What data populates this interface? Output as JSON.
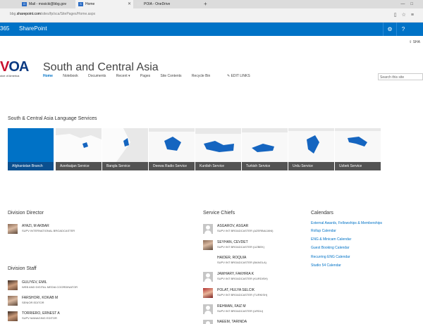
{
  "browser": {
    "tabs": [
      {
        "label": "Mail - mosicki@bbg.gov",
        "icon": "O",
        "active": false
      },
      {
        "label": "Home",
        "icon": "S",
        "active": true
      },
      {
        "label": "POIA - OneDrive",
        "icon": "",
        "active": false
      }
    ],
    "new_tab": "+",
    "url_prefix": "bbg.",
    "url_domain": "sharepoint.com",
    "url_rest": "/sites/fp/sca/SitePages/Home.aspx"
  },
  "suite": {
    "app_prefix": "365",
    "app_name": "SharePoint",
    "accent": "#0072c6"
  },
  "share_label": "SHA",
  "site": {
    "logo_text_v": "V",
    "logo_text_oa": "OA",
    "logo_sub": "oice of America",
    "title": "South and Central Asia",
    "nav": [
      {
        "label": "Home",
        "current": true
      },
      {
        "label": "Notebook",
        "current": false
      },
      {
        "label": "Documents",
        "current": false
      },
      {
        "label": "Recent ▾",
        "current": false
      },
      {
        "label": "Pages",
        "current": false
      },
      {
        "label": "Site Contents",
        "current": false
      },
      {
        "label": "Recycle Bin",
        "current": false
      }
    ],
    "edit_links": "✎ EDIT LINKS",
    "search_placeholder": "Search this site"
  },
  "language_services": {
    "heading": "South & Central Asia Language Services",
    "tiles": [
      {
        "label": "Afghanistan Branch"
      },
      {
        "label": "Azerbaijan Service"
      },
      {
        "label": "Bangla Service"
      },
      {
        "label": "Deewa Radio Service"
      },
      {
        "label": "Kurdish Service"
      },
      {
        "label": "Turkish Service"
      },
      {
        "label": "Urdu Service"
      },
      {
        "label": "Uzbek Service"
      }
    ]
  },
  "division_director": {
    "heading": "Division Director",
    "people": [
      {
        "name": "AYAZI, M AKBAR",
        "title": "SUPV INTERNATIONAL BROADCASTER"
      }
    ]
  },
  "division_staff": {
    "heading": "Division Staff",
    "people": [
      {
        "name": "GULIYEV, EMIL",
        "title": "WEB AND DIGITAL MEDIA COORDINATOR"
      },
      {
        "name": "FARSHORI, KOKAB M",
        "title": "SENIOR EDITOR"
      },
      {
        "name": "TORRIERO, ERNEST A",
        "title": "SUPV MANAGING EDITOR"
      }
    ]
  },
  "service_chiefs": {
    "heading": "Service Chiefs",
    "people": [
      {
        "name": "ASGAROV, ASGAR",
        "title": "SUPV INT BROADCASTER (AZERBAIJANI)"
      },
      {
        "name": "SEYHAN, CEVDET",
        "title": "SUPV INT BROADCASTER (UZBEK)"
      },
      {
        "name": "HAIDER, ROQUIA",
        "title": "SUPV INT BROADCASTER (BANGLA)"
      },
      {
        "name": "JAWHARY, FAKHRIA K",
        "title": "SUPV INT BROADCASTER (KURDISH)"
      },
      {
        "name": "POLAT, HULYA SELCIK",
        "title": "SUPV INT BROADCASTER (TURKISH)"
      },
      {
        "name": "REHMAN, FAIZ M",
        "title": "SUPV INT BROADCASTER (URDU)"
      },
      {
        "name": "NAEEM, TARINDA",
        "title": ""
      }
    ]
  },
  "calendars": {
    "heading": "Calendars",
    "links": [
      "External Awards, Fellowships & Memberships",
      "Rollup Calendar",
      "ENG & Minicam Calendar",
      "Guest Booking Calendar",
      "Recurring ENG Calendar",
      "Studio 54 Calendar"
    ]
  }
}
